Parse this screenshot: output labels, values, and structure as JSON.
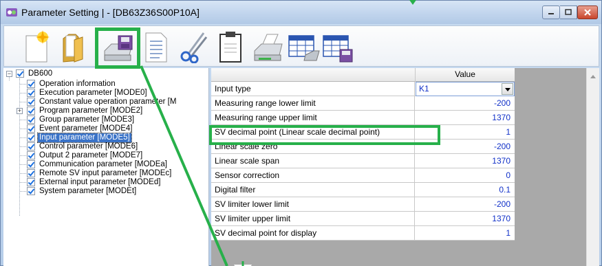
{
  "window": {
    "title": "Parameter Setting |  - [DB63Z36S00P10A]"
  },
  "toolbar": {
    "buttons": [
      {
        "icon": "new-file-icon"
      },
      {
        "icon": "open-folder-icon"
      },
      {
        "icon": "save-to-device-icon"
      },
      {
        "icon": "document-icon"
      },
      {
        "icon": "scissors-icon"
      },
      {
        "icon": "clipboard-icon"
      },
      {
        "icon": "printer-icon"
      },
      {
        "icon": "table-transfer-icon"
      },
      {
        "icon": "table-save-icon"
      }
    ]
  },
  "tree": {
    "root": "DB600",
    "items": [
      {
        "label": "Operation information"
      },
      {
        "label": "Execution parameter [MODE0]"
      },
      {
        "label": "Constant value operation parameter [M"
      },
      {
        "label": "Program parameter [MODE2]"
      },
      {
        "label": "Group parameter [MODE3]"
      },
      {
        "label": "Event parameter [MODE4]"
      },
      {
        "label": "Input parameter [MODE5]"
      },
      {
        "label": "Control parameter [MODE6]"
      },
      {
        "label": "Output 2 parameter [MODE7]"
      },
      {
        "label": "Communication parameter [MODEa]"
      },
      {
        "label": "Remote SV input parameter [MODEc]"
      },
      {
        "label": "External input parameter [MODEd]"
      },
      {
        "label": "System parameter [MODEt]"
      }
    ]
  },
  "grid": {
    "header_value": "Value",
    "rows": [
      {
        "name": "Input type",
        "value": "K1"
      },
      {
        "name": "Measuring range lower limit",
        "value": "-200"
      },
      {
        "name": "Measuring range upper limit",
        "value": "1370"
      },
      {
        "name": "SV decimal point (Linear scale decimal point)",
        "value": "1"
      },
      {
        "name": "Linear scale zero",
        "value": "-200"
      },
      {
        "name": "Linear scale span",
        "value": "1370"
      },
      {
        "name": "Sensor correction",
        "value": "0"
      },
      {
        "name": "Digital filter",
        "value": "0.1"
      },
      {
        "name": "SV limiter lower limit",
        "value": "-200"
      },
      {
        "name": "SV limiter upper limit",
        "value": "1370"
      },
      {
        "name": "SV decimal point for display",
        "value": "1"
      }
    ]
  },
  "colors": {
    "highlight": "#27b04a",
    "value_text": "#1030c8",
    "selection": "#3a73c8"
  }
}
